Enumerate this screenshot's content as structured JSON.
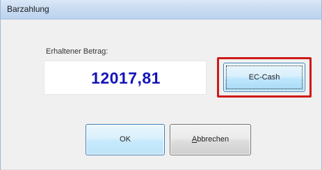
{
  "window": {
    "title": "Barzahlung"
  },
  "payment": {
    "amount_label": "Erhaltener Betrag:",
    "amount_value": "12017,81",
    "amount_color": "#1414b8"
  },
  "buttons": {
    "ec_cash_label": "EC-Cash",
    "ok_label": "OK",
    "cancel_mnemonic": "A",
    "cancel_rest": "bbrechen"
  },
  "annotation": {
    "highlight_color": "#d01818"
  }
}
